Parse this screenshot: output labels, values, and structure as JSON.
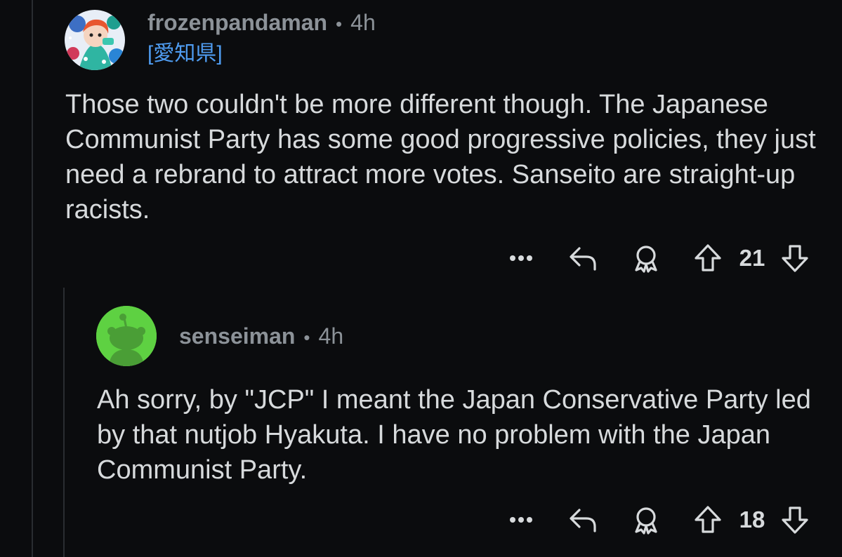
{
  "comments": [
    {
      "username": "frozenpandaman",
      "separator": "•",
      "time": "4h",
      "flair": "[愛知県]",
      "body": "Those two couldn't be more different though. The Japanese Communist Party has some good progressive policies, they just need a rebrand to attract more votes. Sanseito are straight-up racists.",
      "more": "•••",
      "votes": "21"
    },
    {
      "username": "senseiman",
      "separator": "•",
      "time": "4h",
      "body": "Ah sorry, by \"JCP\" I meant the Japan Conservative Party led by that nutjob Hyakuta. I have no problem with the Japan Communist Party.",
      "more": "•••",
      "votes": "18"
    }
  ],
  "icons": {
    "more": "more-options-icon",
    "reply": "reply-icon",
    "award": "award-icon",
    "upvote": "upvote-icon",
    "downvote": "downvote-icon"
  },
  "colors": {
    "background": "#0b0c0e",
    "text": "#d7dadc",
    "meta": "#8c9298",
    "flair": "#4f9cf0",
    "default_avatar": "#5ed142"
  }
}
